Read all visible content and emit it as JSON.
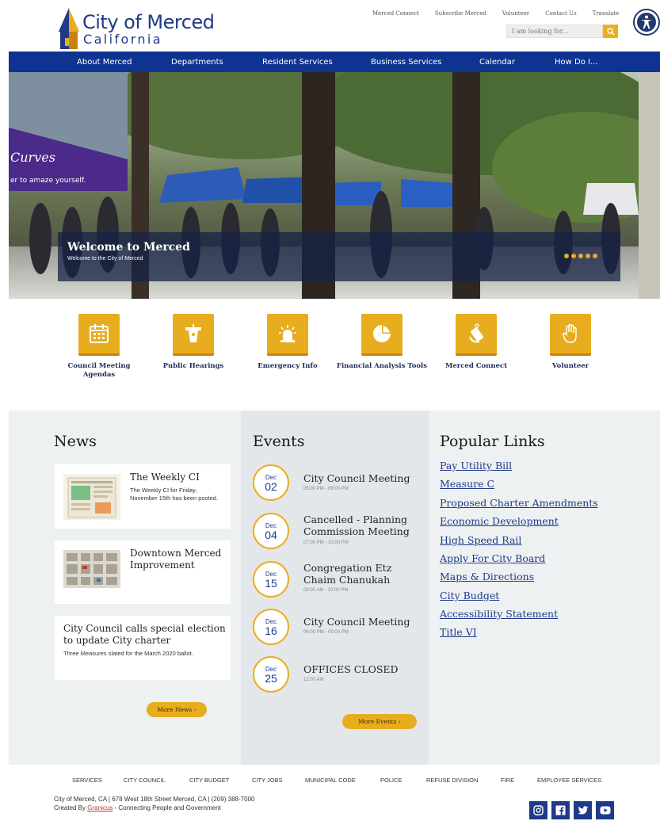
{
  "header": {
    "logo_title": "City of Merced",
    "logo_subtitle": "California",
    "utility_links": [
      "Merced Connect",
      "Subscribe Merced",
      "Volunteer",
      "Contact Us",
      "Translate"
    ],
    "search_placeholder": "I am looking for..."
  },
  "nav": {
    "items": [
      "About Merced",
      "Departments",
      "Resident Services",
      "Business Services",
      "Calendar",
      "How Do I..."
    ]
  },
  "hero": {
    "title": "Welcome to Merced",
    "subtitle": "Welcome to the City of Merced",
    "tent_text_1": "Curves",
    "tent_text_2": "er to amaze yourself.",
    "slide_count": 5
  },
  "quick_links": [
    {
      "label": "Council Meeting Agendas",
      "icon": "calendar-icon"
    },
    {
      "label": "Public Hearings",
      "icon": "podium-icon"
    },
    {
      "label": "Emergency Info",
      "icon": "alarm-light-icon"
    },
    {
      "label": "Financial Analysis Tools",
      "icon": "pie-chart-icon"
    },
    {
      "label": "Merced Connect",
      "icon": "phone-hand-icon"
    },
    {
      "label": "Volunteer",
      "icon": "raised-hand-icon"
    }
  ],
  "news": {
    "heading": "News",
    "items": [
      {
        "title": "The Weekly CI",
        "desc": "The Weekly CI for Friday, November 15th has been posted."
      },
      {
        "title": "Downtown Merced Improvement",
        "desc": ""
      },
      {
        "title": "City Council calls special election to update City charter",
        "desc": "Three Measures slated for the March 2020 ballot."
      }
    ],
    "more_label": "More News ›"
  },
  "events": {
    "heading": "Events",
    "items": [
      {
        "month": "Dec",
        "day": "02",
        "title": "City Council Meeting",
        "time": "06:00 PM - 09:00 PM"
      },
      {
        "month": "Dec",
        "day": "04",
        "title": "Cancelled - Planning Commission Meeting",
        "time": "07:00 PM - 10:00 PM"
      },
      {
        "month": "Dec",
        "day": "15",
        "title": "Congregation Etz Chaim Chanukah",
        "time": "08:00 AM - 10:00 PM"
      },
      {
        "month": "Dec",
        "day": "16",
        "title": "City Council Meeting",
        "time": "06:00 PM - 09:00 PM"
      },
      {
        "month": "Dec",
        "day": "25",
        "title": "OFFICES CLOSED",
        "time": "12:00 AM"
      }
    ],
    "more_label": "More Events ›"
  },
  "popular_links": {
    "heading": "Popular Links",
    "items": [
      "Pay Utility Bill",
      "Measure C",
      "Proposed Charter Amendments",
      "Economic Development",
      "High Speed Rail",
      "Apply For City Board",
      "Maps & Directions",
      "City Budget",
      "Accessibility Statement",
      "Title VI"
    ]
  },
  "footer": {
    "links": [
      "SERVICES",
      "CITY COUNCIL",
      "CITY BUDGET",
      "CITY JOBS",
      "MUNICIPAL CODE",
      "POLICE",
      "REFUSE DIVISION",
      "FIRE",
      "EMPLOYEE SERVICES"
    ],
    "address": "City of Merced, CA | 678 West 18th Street Merced, CA | (209) 388-7000",
    "credit_prefix": "Created By ",
    "credit_brand": "Granicus",
    "credit_suffix": " - Connecting People and Government",
    "social": [
      "instagram-icon",
      "facebook-icon",
      "twitter-icon",
      "youtube-icon"
    ]
  },
  "colors": {
    "nav_blue": "#0f3391",
    "accent_gold": "#e8ad1f",
    "link_blue": "#1f3a8a"
  }
}
